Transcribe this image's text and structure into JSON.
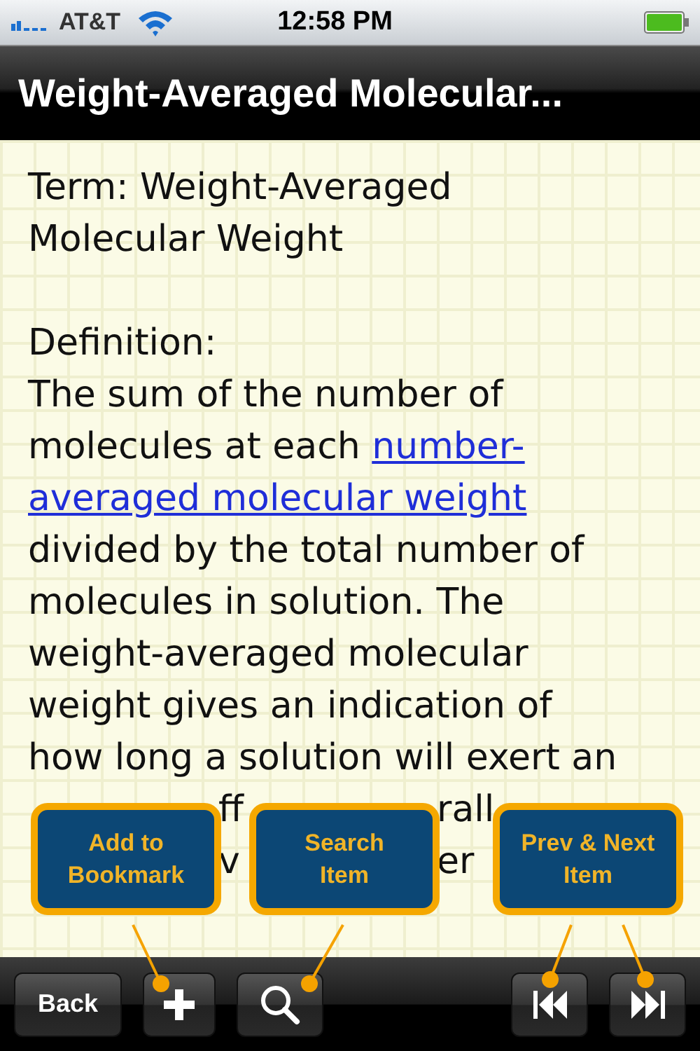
{
  "status_bar": {
    "carrier": "AT&T",
    "time": "12:58 PM"
  },
  "nav_bar": {
    "title": "Weight-Averaged Molecular..."
  },
  "term": {
    "lines": [
      "Term: Weight-Averaged",
      "Molecular Weight"
    ]
  },
  "definition": {
    "heading": "Definition:",
    "lines": [
      {
        "kind": "full",
        "segments": [
          {
            "text": "The sum of the number of",
            "link": false
          }
        ]
      },
      {
        "kind": "full",
        "segments": [
          {
            "text": "molecules at each ",
            "link": false
          },
          {
            "text": "number-",
            "link": true
          }
        ]
      },
      {
        "kind": "full",
        "segments": [
          {
            "text": "averaged molecular weight",
            "link": true
          }
        ]
      },
      {
        "kind": "full",
        "segments": [
          {
            "text": "divided by the total number of",
            "link": false
          }
        ]
      },
      {
        "kind": "full",
        "segments": [
          {
            "text": "molecules in solution. The",
            "link": false
          }
        ]
      },
      {
        "kind": "full",
        "segments": [
          {
            "text": "weight-averaged molecular",
            "link": false
          }
        ]
      },
      {
        "kind": "full",
        "segments": [
          {
            "text": "weight gives an indication of",
            "link": false
          }
        ]
      },
      {
        "kind": "full",
        "segments": [
          {
            "text": "how long a solution will exert an",
            "link": false
          }
        ]
      },
      {
        "kind": "obscured",
        "segments": [
          {
            "text": "ff",
            "link": false
          },
          {
            "text": "rall",
            "link": false
          }
        ]
      },
      {
        "kind": "obscured",
        "segments": [
          {
            "text": "v",
            "link": false
          },
          {
            "text": "er",
            "link": false
          }
        ]
      }
    ]
  },
  "callouts": [
    {
      "lines": [
        "Add to",
        "Bookmark"
      ]
    },
    {
      "lines": [
        "Search",
        "Item"
      ]
    },
    {
      "lines": [
        "Prev & Next",
        "Item"
      ]
    }
  ],
  "toolbar": {
    "back": "Back"
  }
}
